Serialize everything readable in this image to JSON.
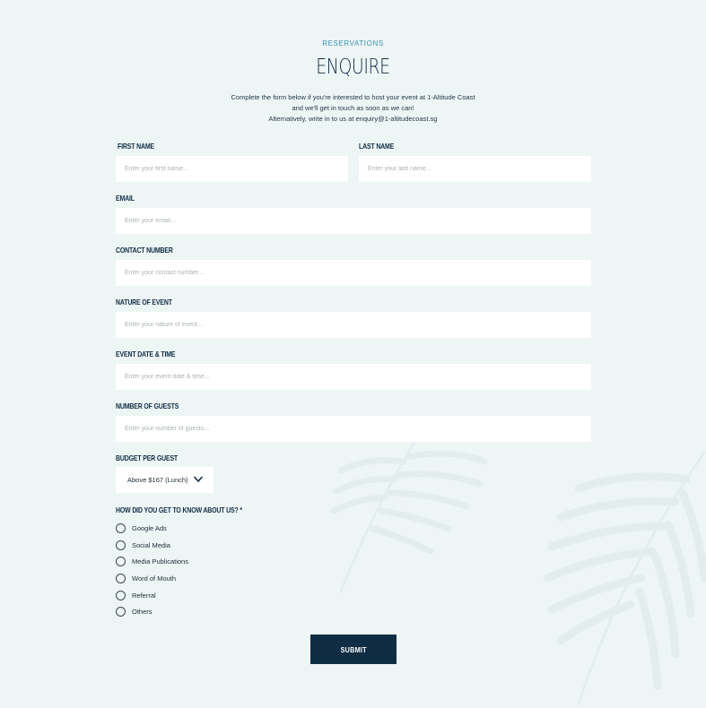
{
  "header": {
    "eyebrow": "RESERVATIONS",
    "title": "ENQUIRE",
    "intro_line1": "Complete the form below if you're interested to host your event at 1-Altitude Coast",
    "intro_line2": "and we'll get in touch as soon as we can!",
    "intro_line3": "Alternatively, write in to us at enquiry@1-altitudecoast.sg"
  },
  "form": {
    "first_name": {
      "label": "FIRST NAME",
      "placeholder": "Enter your first name...",
      "value": ""
    },
    "last_name": {
      "label": "LAST NAME",
      "placeholder": "Enter your last name...",
      "value": ""
    },
    "email": {
      "label": "EMAIL",
      "placeholder": "Enter your email...",
      "value": ""
    },
    "contact": {
      "label": "CONTACT NUMBER",
      "placeholder": "Enter your contact number...",
      "value": ""
    },
    "nature": {
      "label": "NATURE OF EVENT",
      "placeholder": "Enter your nature of event...",
      "value": ""
    },
    "datetime": {
      "label": "EVENT DATE & TIME",
      "placeholder": "Enter your event date & time...",
      "value": ""
    },
    "guests": {
      "label": "NUMBER OF GUESTS",
      "placeholder": "Enter your number of guests...",
      "value": ""
    },
    "budget": {
      "label": "BUDGET PER GUEST",
      "selected": "Above $167 (Lunch)"
    },
    "source": {
      "label": "HOW DID YOU GET TO KNOW ABOUT US? *",
      "options": [
        "Google Ads",
        "Social Media",
        "Media Publications",
        "Word of Mouth",
        "Referral",
        "Others"
      ]
    },
    "submit_label": "SUBMIT"
  },
  "colors": {
    "background": "#eef5f5",
    "primary": "#0e2d45",
    "accent": "#3a8fb0",
    "field_bg": "#ffffff"
  },
  "icons": {
    "select_chevron": "chevron-down-icon",
    "background_decoration": "fern-leaf-icon"
  }
}
